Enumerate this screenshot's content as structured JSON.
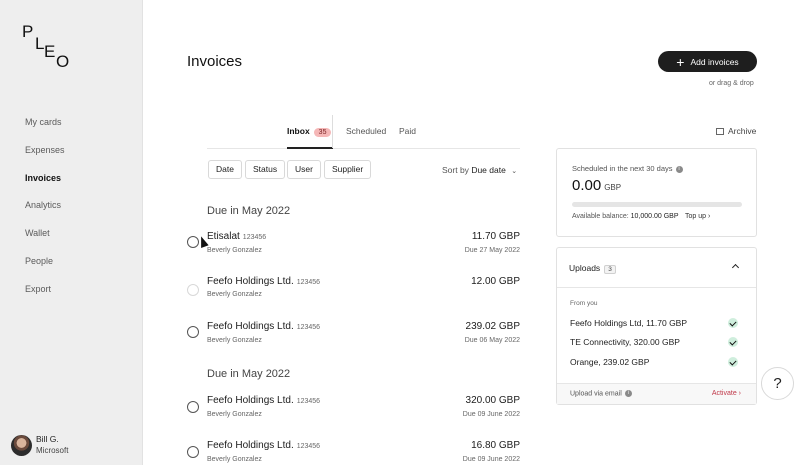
{
  "brand": {
    "logo_text": "PLEO"
  },
  "sidebar": {
    "items": [
      {
        "label": "My cards",
        "active": false
      },
      {
        "label": "Expenses",
        "active": false
      },
      {
        "label": "Invoices",
        "active": true
      },
      {
        "label": "Analytics",
        "active": false
      },
      {
        "label": "Wallet",
        "active": false
      },
      {
        "label": "People",
        "active": false
      },
      {
        "label": "Export",
        "active": false
      }
    ],
    "user": {
      "name": "Bill G.",
      "org": "Microsoft"
    }
  },
  "header": {
    "title": "Invoices",
    "add_button": "Add invoices",
    "drag_hint": "or drag & drop"
  },
  "tabs": [
    {
      "label": "Inbox",
      "badge": "35",
      "active": true
    },
    {
      "label": "Scheduled",
      "active": false
    },
    {
      "label": "Paid",
      "active": false
    }
  ],
  "filters": [
    "Date",
    "Status",
    "User",
    "Supplier"
  ],
  "sort": {
    "label": "Sort by",
    "value": "Due date"
  },
  "sections": [
    {
      "heading": "Due in May 2022",
      "rows": [
        {
          "vendor": "Etisalat",
          "ref": "123456",
          "person": "Beverly Gonzalez",
          "amount": "11.70 GBP",
          "due": "Due 27 May 2022"
        },
        {
          "vendor": "Feefo Holdings Ltd.",
          "ref": "123456",
          "person": "Beverly Gonzalez",
          "amount": "12.00 GBP",
          "due": ""
        },
        {
          "vendor": "Feefo Holdings Ltd.",
          "ref": "123456",
          "person": "Beverly Gonzalez",
          "amount": "239.02 GBP",
          "due": "Due 06 May 2022"
        }
      ]
    },
    {
      "heading": "Due in May 2022",
      "rows": [
        {
          "vendor": "Feefo Holdings Ltd.",
          "ref": "123456",
          "person": "Beverly Gonzalez",
          "amount": "320.00 GBP",
          "due": "Due 09 June 2022"
        },
        {
          "vendor": "Feefo Holdings Ltd.",
          "ref": "123456",
          "person": "Beverly Gonzalez",
          "amount": "16.80 GBP",
          "due": "Due 09 June 2022"
        }
      ]
    }
  ],
  "archive": {
    "label": "Archive"
  },
  "scheduled": {
    "label": "Scheduled in the next 30 days",
    "amount": "0.00",
    "currency": "GBP",
    "progress_fraction": 0,
    "balance_label": "Available balance:",
    "balance_value": "10,000.00 GBP",
    "topup": "Top up ›"
  },
  "uploads": {
    "title": "Uploads",
    "count": "3",
    "from_label": "From you",
    "items": [
      "Feefo Holdings Ltd, 11.70 GBP",
      "TE Connectivity, 320.00 GBP",
      "Orange, 239.02 GBP"
    ],
    "via_email": "Upload via email",
    "activate": "Activate ›"
  },
  "help": {
    "label": "?"
  }
}
